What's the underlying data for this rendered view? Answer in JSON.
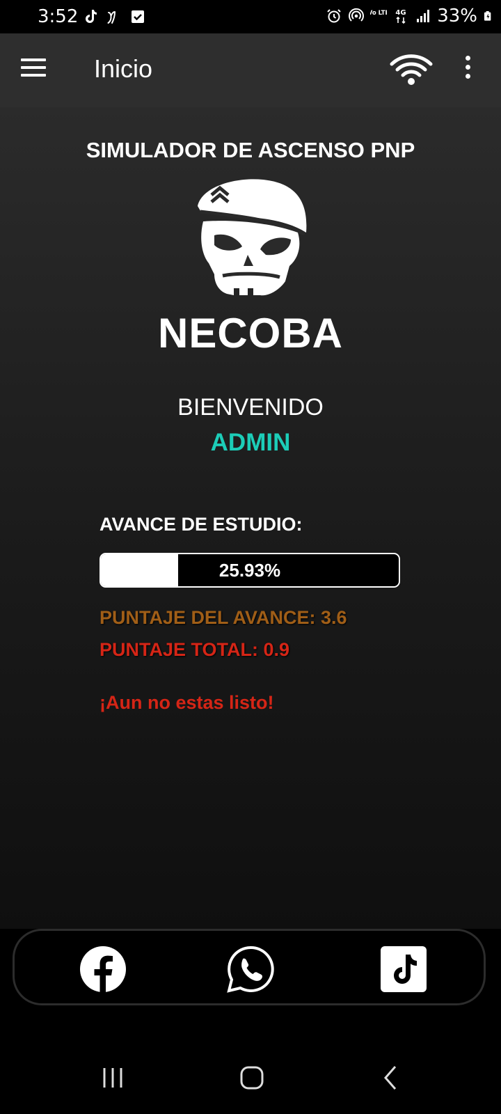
{
  "status_bar": {
    "time": "3:52",
    "battery_percent": "33%",
    "left_icons": [
      "tiktok-icon",
      "yape-icon",
      "checkbox-icon"
    ],
    "right_icons": [
      "alarm-icon",
      "hotspot-icon",
      "volte-icon",
      "4g-icon",
      "signal-icon",
      "battery-icon"
    ],
    "volte_label": "Vo LTE",
    "network_label": "4G"
  },
  "app_bar": {
    "title": "Inicio",
    "icons": [
      "menu-icon",
      "wifi-icon",
      "more-vert-icon"
    ]
  },
  "main": {
    "simulator_title": "SIMULADOR DE ASCENSO PNP",
    "brand_name": "NECOBA",
    "welcome_text": "BIENVENIDO",
    "username": "ADMIN",
    "progress_label": "AVANCE DE ESTUDIO:",
    "progress_value": 25.93,
    "progress_text": "25.93%",
    "score_partial": "PUNTAJE DEL AVANCE: 3.6",
    "score_total": "PUNTAJE TOTAL: 0.9",
    "ready_message": "¡Aun no estas listo!"
  },
  "social": {
    "items": [
      "facebook-icon",
      "whatsapp-icon",
      "tiktok-icon"
    ]
  },
  "nav_bar": {
    "items": [
      "recents-icon",
      "home-icon",
      "back-icon"
    ]
  },
  "colors": {
    "accent_teal": "#1ccdb8",
    "score_partial_color": "#a05e17",
    "score_total_color": "#d52516",
    "appbar_bg": "#2e2e2e"
  }
}
